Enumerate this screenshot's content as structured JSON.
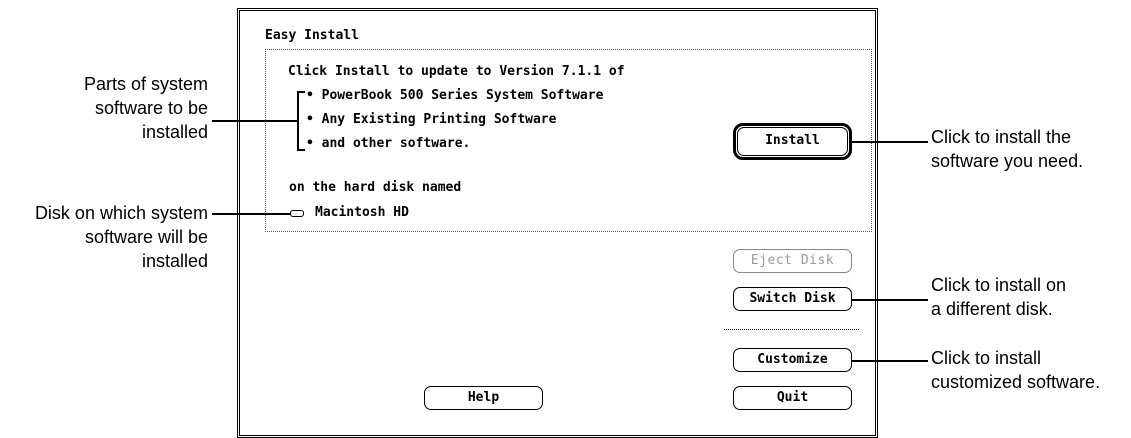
{
  "window": {
    "title": "Easy Install",
    "intro": "Click Install to update to Version 7.1.1 of",
    "items": [
      "• PowerBook 500 Series System Software",
      "• Any Existing Printing Software",
      "• and other software."
    ],
    "disk_label": "on the hard disk named",
    "disk_name": "Macintosh HD"
  },
  "buttons": {
    "install": "Install",
    "eject": "Eject Disk",
    "switch": "Switch Disk",
    "customize": "Customize",
    "help": "Help",
    "quit": "Quit"
  },
  "callouts": {
    "parts": [
      "Parts of system",
      "software to be",
      "installed"
    ],
    "disk": [
      "Disk on which system",
      "software will be",
      "installed"
    ],
    "install": [
      "Click to install the",
      "software you need."
    ],
    "switch": [
      "Click to install on",
      "a different disk."
    ],
    "customize": [
      "Click to install",
      "customized software."
    ]
  },
  "icons": {
    "disk": "hard-disk-icon"
  }
}
